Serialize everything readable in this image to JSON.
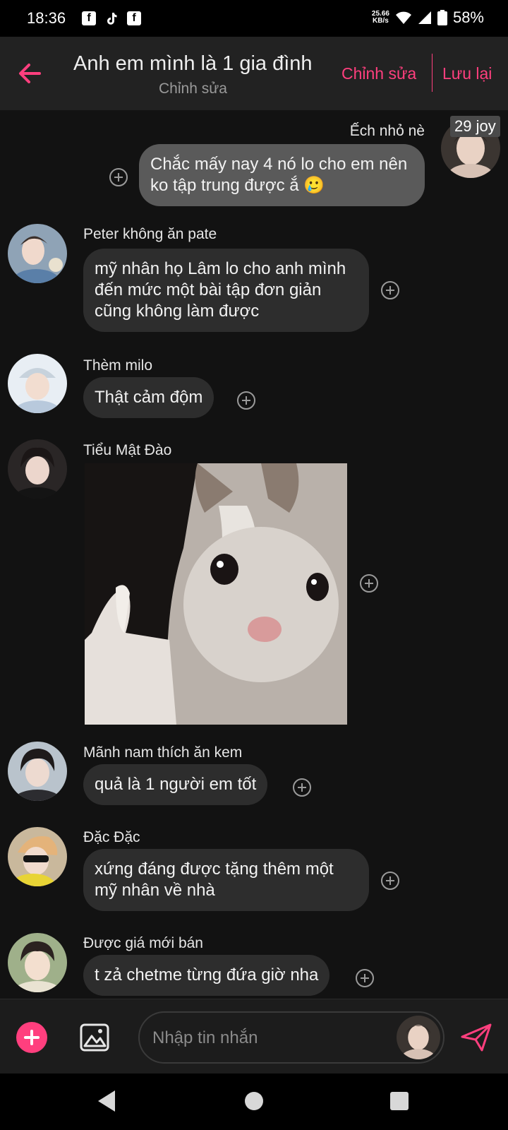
{
  "status_bar": {
    "time": "18:36",
    "app_icons": [
      "facebook-icon",
      "tiktok-icon",
      "facebook-icon"
    ],
    "net_speed_value": "25.66",
    "net_speed_unit": "KB/s",
    "battery": "58%"
  },
  "header": {
    "title": "Anh em mình là 1 gia đình",
    "subtitle": "Chỉnh sửa",
    "edit_label": "Chỉnh sửa",
    "save_label": "Lưu lại"
  },
  "messages": [
    {
      "sender": "Ếch nhỏ nè",
      "text": "Chắc mấy nay 4 nó lo cho em nên ko tập trung được ắ 🥲",
      "self": true,
      "tag": "29 joy"
    },
    {
      "sender": "Peter không ăn pate",
      "text": "mỹ nhân họ Lâm lo cho anh mình đến mức một bài tập đơn giản cũng không làm được"
    },
    {
      "sender": "Thèm milo",
      "text": "Thật cảm độm"
    },
    {
      "sender": "Tiểu Mật Đào",
      "image": "crying-cat-thumbs-up-meme"
    },
    {
      "sender": "Mãnh nam thích ăn kem",
      "text": "quả là 1 người em tốt"
    },
    {
      "sender": "Đặc Đặc",
      "text": "xứng đáng được tặng thêm một mỹ nhân về nhà"
    },
    {
      "sender": "Được giá mới bán",
      "text": "t zả chetme từng đứa giờ nha"
    }
  ],
  "composer": {
    "placeholder": "Nhập tin nhắn"
  },
  "colors": {
    "accent": "#ff3f7e",
    "background": "#121212",
    "header": "#222222",
    "bubble": "#2d2d2d",
    "bubble_self": "#5a5a5a"
  }
}
